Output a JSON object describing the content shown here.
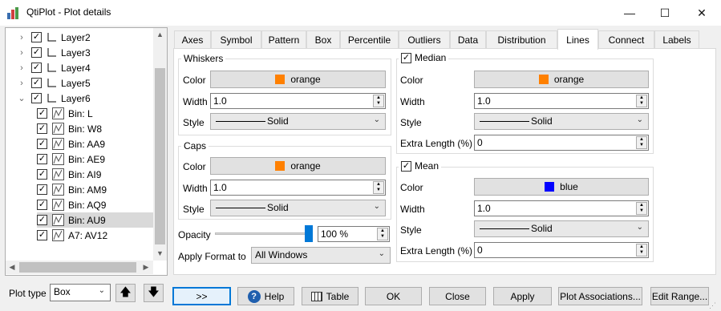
{
  "window": {
    "title": "QtiPlot - Plot details",
    "minimize": "—",
    "maximize": "☐",
    "close": "✕"
  },
  "tree": {
    "items": [
      {
        "label": "Layer2",
        "level": 0,
        "expanded": false,
        "checked": true
      },
      {
        "label": "Layer3",
        "level": 0,
        "expanded": false,
        "checked": true
      },
      {
        "label": "Layer4",
        "level": 0,
        "expanded": false,
        "checked": true
      },
      {
        "label": "Layer5",
        "level": 0,
        "expanded": false,
        "checked": true
      },
      {
        "label": "Layer6",
        "level": 0,
        "expanded": true,
        "checked": true
      },
      {
        "label": "Bin: L",
        "level": 1,
        "checked": true
      },
      {
        "label": "Bin: W8",
        "level": 1,
        "checked": true
      },
      {
        "label": "Bin: AA9",
        "level": 1,
        "checked": true
      },
      {
        "label": "Bin: AE9",
        "level": 1,
        "checked": true
      },
      {
        "label": "Bin: AI9",
        "level": 1,
        "checked": true
      },
      {
        "label": "Bin: AM9",
        "level": 1,
        "checked": true
      },
      {
        "label": "Bin: AQ9",
        "level": 1,
        "checked": true
      },
      {
        "label": "Bin: AU9",
        "level": 1,
        "checked": true,
        "selected": true
      },
      {
        "label": "A7: AV12",
        "level": 1,
        "checked": true
      }
    ]
  },
  "plot_type": {
    "label": "Plot type",
    "value": "Box"
  },
  "tabs": [
    "Axes",
    "Symbol",
    "Pattern",
    "Box",
    "Percentile",
    "Outliers",
    "Data",
    "Distribution",
    "Lines",
    "Connect",
    "Labels"
  ],
  "active_tab": "Lines",
  "whiskers": {
    "title": "Whiskers",
    "color_label": "Color",
    "color_name": "orange",
    "color_hex": "#ff8000",
    "width_label": "Width",
    "width": "1.0",
    "style_label": "Style",
    "style": "Solid"
  },
  "caps": {
    "title": "Caps",
    "color_label": "Color",
    "color_name": "orange",
    "color_hex": "#ff8000",
    "width_label": "Width",
    "width": "1.0",
    "style_label": "Style",
    "style": "Solid"
  },
  "opacity": {
    "label": "Opacity",
    "value": "100 %",
    "fraction": 1.0
  },
  "apply_format": {
    "label": "Apply Format to",
    "value": "All Windows"
  },
  "median": {
    "title": "Median",
    "checked": true,
    "color_label": "Color",
    "color_name": "orange",
    "color_hex": "#ff8000",
    "width_label": "Width",
    "width": "1.0",
    "style_label": "Style",
    "style": "Solid",
    "extra_label": "Extra Length (%)",
    "extra": "0"
  },
  "mean": {
    "title": "Mean",
    "checked": true,
    "color_label": "Color",
    "color_name": "blue",
    "color_hex": "#0000ff",
    "width_label": "Width",
    "width": "1.0",
    "style_label": "Style",
    "style": "Solid",
    "extra_label": "Extra Length (%)",
    "extra": "0"
  },
  "buttons": {
    "more": ">>",
    "help": "Help",
    "table": "Table",
    "ok": "OK",
    "close": "Close",
    "apply": "Apply",
    "associations": "Plot Associations...",
    "edit_range": "Edit Range..."
  }
}
